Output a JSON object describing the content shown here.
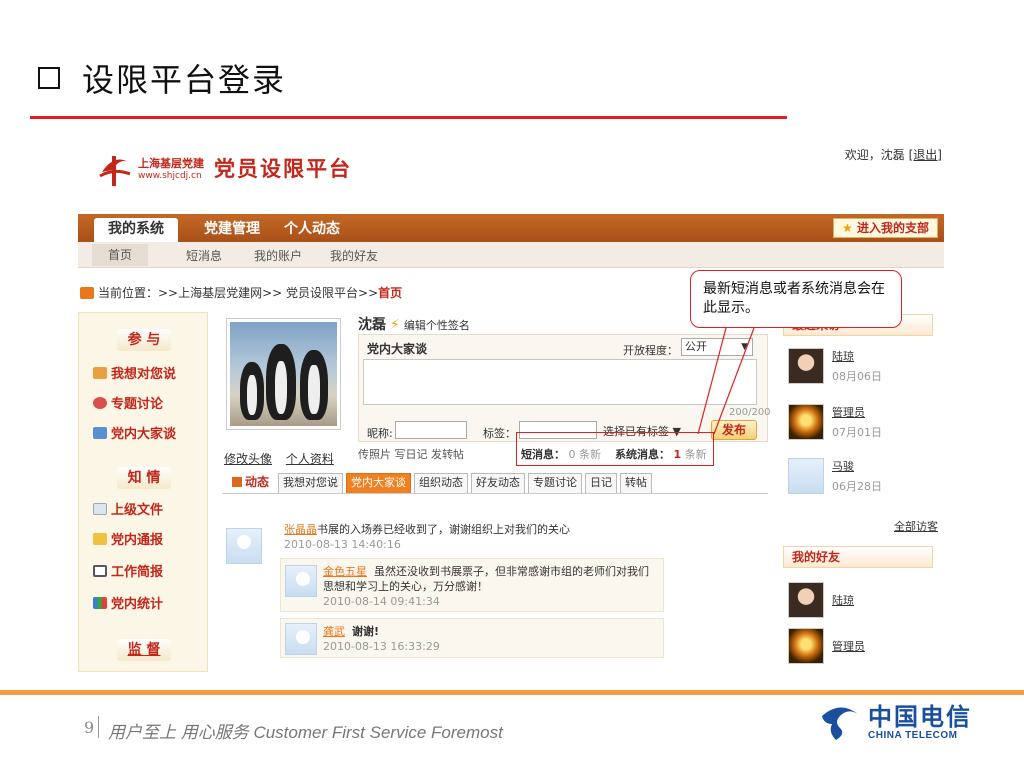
{
  "slide": {
    "title": "设限平台登录",
    "page_number": "9",
    "slogan": "用户至上 用心服务 Customer First Service Foremost",
    "brand_cn": "中国电信",
    "brand_en": "CHINA TELECOM"
  },
  "site": {
    "org_name": "上海基层党建",
    "org_url": "www.shjcdj.cn",
    "platform_name": "党员设限平台",
    "welcome_prefix": "欢迎，沈磊",
    "logout": "[退出]"
  },
  "nav": {
    "main": [
      "我的系统",
      "党建管理",
      "个人动态"
    ],
    "enter_branch": "进入我的支部",
    "sub": [
      "首页",
      "短消息",
      "我的账户",
      "我的好友"
    ]
  },
  "breadcrumb": {
    "prefix": "当前位置：>>上海基层党建网>> 党员设限平台>>",
    "current": "首页"
  },
  "sidebar": {
    "section1": "参 与",
    "items1": [
      "我想对您说",
      "专题讨论",
      "党内大家谈"
    ],
    "section2": "知 情",
    "items2": [
      "上级文件",
      "党内通报",
      "工作简报",
      "党内统计"
    ],
    "section3": "监 督"
  },
  "profile": {
    "change_avatar": "修改头像",
    "personal_info": "个人资料",
    "name": "沈磊",
    "edit_signature": "编辑个性签名"
  },
  "post": {
    "title": "党内大家谈",
    "open_level_label": "开放程度：",
    "open_level_value": "公开",
    "counter": "200/200",
    "nickname_label": "昵称:",
    "tag_label": "标签：",
    "tag_select": "选择已有标签",
    "publish": "发布",
    "types": "传照片 写日记 发转帖"
  },
  "messages": {
    "short_label": "短消息：",
    "short_value": "0 条新",
    "system_label": "系统消息：",
    "system_count": "1",
    "system_suffix": "条新"
  },
  "tabs": {
    "lead": "动态",
    "items": [
      "我想对您说",
      "党内大家谈",
      "组织动态",
      "好友动态",
      "专题讨论",
      "日记",
      "转帖"
    ],
    "active_index": 1
  },
  "feed": {
    "item1_name": "张晶晶",
    "item1_text": "书展的入场券已经收到了，谢谢组织上对我们的关心",
    "item1_time": "2010-08-13 14:40:16",
    "reply1_name": "金色五星",
    "reply1_text": "虽然还没收到书展票子，但非常感谢市组的老师们对我们思想和学习上的关心，万分感谢！",
    "reply1_time": "2010-08-14 09:41:34",
    "reply2_name": "龚武",
    "reply2_text": "谢谢!",
    "reply2_time": "2010-08-13 16:33:29"
  },
  "recent_visits": {
    "title": "最近来访",
    "visitors": [
      {
        "name": "陆琼",
        "date": "08月06日"
      },
      {
        "name": "管理员",
        "date": "07月01日"
      },
      {
        "name": "马骏",
        "date": "06月28日"
      }
    ],
    "all": "全部访客"
  },
  "friends": {
    "title": "我的好友",
    "list": [
      "陆琼",
      "管理员"
    ]
  },
  "callout": {
    "text": "最新短消息或者系统消息会在此显示。"
  },
  "colors": {
    "accent_red": "#e02020",
    "nav_brown": "#b55a1f",
    "footer_orange": "#f39c4a",
    "brand_blue": "#1a4fa0"
  }
}
